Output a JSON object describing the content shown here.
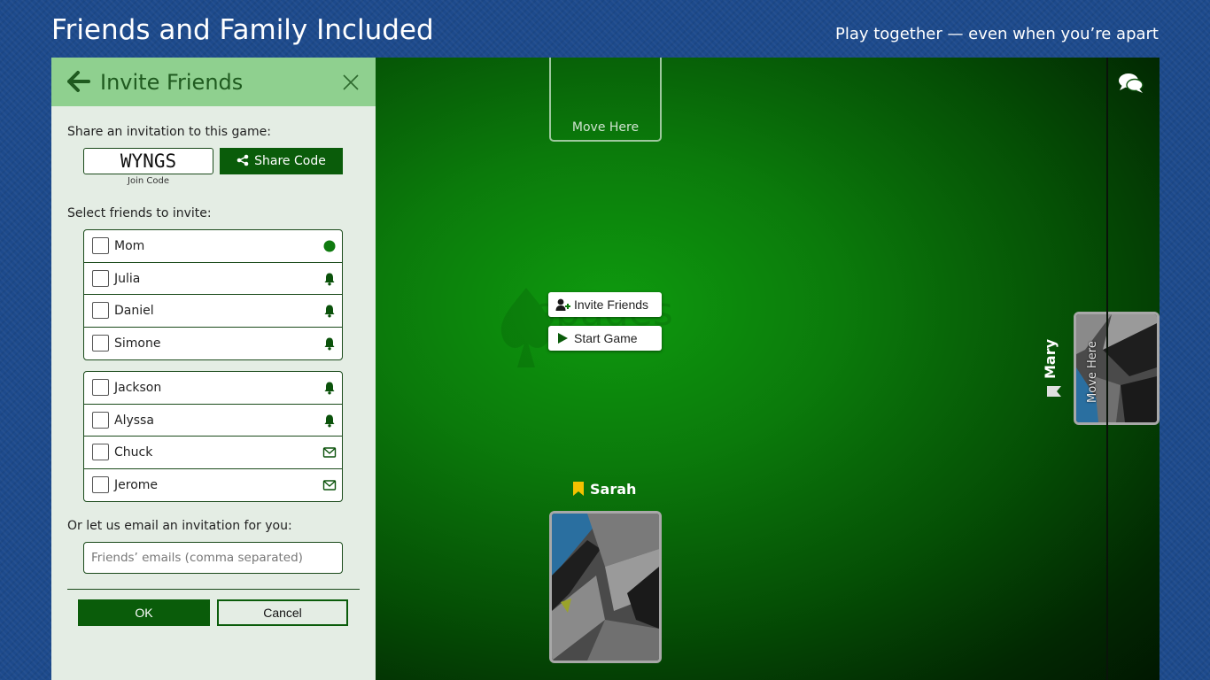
{
  "banner": {
    "title": "Friends and Family Included",
    "tagline": "Play together — even when you’re apart"
  },
  "invite_panel": {
    "title": "Invite Friends",
    "share_prompt": "Share an invitation to this game:",
    "join_code": "WYNGS",
    "join_code_caption": "Join Code",
    "share_button": "Share Code",
    "select_prompt": "Select friends to invite:",
    "online_group": [
      {
        "name": "Mom",
        "status": "online-dot-icon"
      },
      {
        "name": "Julia",
        "status": "bell-icon"
      },
      {
        "name": "Daniel",
        "status": "bell-icon"
      },
      {
        "name": "Simone",
        "status": "bell-icon"
      }
    ],
    "other_group": [
      {
        "name": "Jackson",
        "status": "bell-icon"
      },
      {
        "name": "Alyssa",
        "status": "bell-icon"
      },
      {
        "name": "Chuck",
        "status": "envelope-icon"
      },
      {
        "name": "Jerome",
        "status": "envelope-icon"
      }
    ],
    "email_prompt": "Or let us email an invitation for you:",
    "email_placeholder": "Friends’ emails (comma separated)",
    "ok_button": "OK",
    "cancel_button": "Cancel"
  },
  "table": {
    "top_slot_label": "Move Here",
    "invite_button": "Invite Friends",
    "start_button": "Start Game",
    "player_bottom": "Sarah",
    "player_right": "Mary",
    "right_slot_label": "Move Here"
  },
  "colors": {
    "panel_header": "#8fd08f",
    "primary_green": "#0a5c0a",
    "table_green": "#0b7a0b",
    "background_blue": "#1d4a8c",
    "sarah_flag": "#f2c200"
  }
}
